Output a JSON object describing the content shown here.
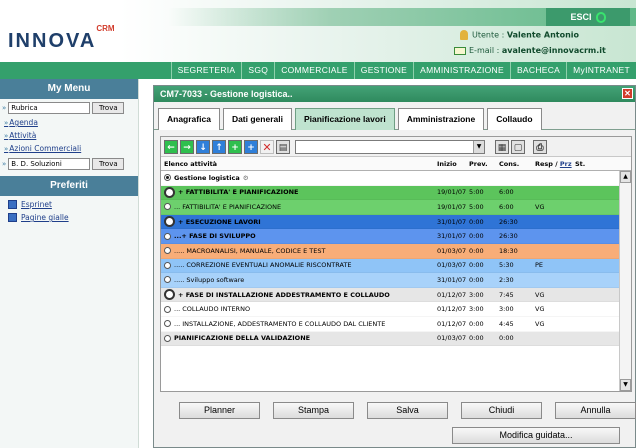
{
  "header": {
    "logo": "INNOVA",
    "logo_sup": "CRM",
    "exit_label": "ESCI",
    "user_label": "Utente :",
    "user_name": "Valente Antonio",
    "email_label": "E-mail :",
    "email": "avalente@innovacrm.it"
  },
  "nav": [
    "SEGRETERIA",
    "SGQ",
    "COMMERCIALE",
    "GESTIONE",
    "AMMINISTRAZIONE",
    "BACHECA",
    "MyINTRANET"
  ],
  "sidebar": {
    "title": "My Menu",
    "search1_value": "Rubrica",
    "search_button": "Trova",
    "links": [
      "Agenda",
      "Attività",
      "Azioni Commerciali"
    ],
    "search2_value": "B. D. Soluzioni",
    "prefs_title": "Preferiti",
    "prefs": [
      "Esprinet",
      "Pagine gialle"
    ]
  },
  "window": {
    "title": "CM7-7033 - Gestione logistica..",
    "tabs": [
      "Anagrafica",
      "Dati generali",
      "Pianificazione lavori",
      "Amministrazione",
      "Collaudo"
    ],
    "active_tab": "Pianificazione lavori"
  },
  "table": {
    "headers": {
      "name": "Elenco attività",
      "inizio": "Inizio",
      "prev": "Prev.",
      "cons": "Cons.",
      "resp": "Resp",
      "prz": "Prz",
      "st": "St."
    },
    "root": "Gestione logistica",
    "rows": [
      {
        "name": "+ FATTIBILITA' E PIANIFICAZIONE",
        "inizio": "19/01/07",
        "prev": "5:00",
        "cons": "6:00",
        "resp": "",
        "color": "#5cc45c",
        "bold": true,
        "big": true
      },
      {
        "name": "... FATTIBILITA' E PIANIFICAZIONE",
        "inizio": "19/01/07",
        "prev": "5:00",
        "cons": "6:00",
        "resp": "VG",
        "color": "#6dd06d",
        "bold": false,
        "big": false
      },
      {
        "name": "+ ESECUZIONE LAVORI",
        "inizio": "31/01/07",
        "prev": "0:00",
        "cons": "26:30",
        "resp": "",
        "color": "#2f74d6",
        "bold": true,
        "big": true
      },
      {
        "name": "...+ FASE DI SVILUPPO",
        "inizio": "31/01/07",
        "prev": "0:00",
        "cons": "26:30",
        "resp": "",
        "color": "#5d94ee",
        "bold": true,
        "big": false
      },
      {
        "name": "..... MACROANALISI, MANUALE, CODICE E TEST",
        "inizio": "01/03/07",
        "prev": "0:00",
        "cons": "18:30",
        "resp": "",
        "color": "#f8ad78",
        "bold": false,
        "big": false
      },
      {
        "name": "..... CORREZIONE EVENTUALI ANOMALIE RISCONTRATE",
        "inizio": "01/03/07",
        "prev": "0:00",
        "cons": "5:30",
        "resp": "PE",
        "color": "#8fc4f7",
        "bold": false,
        "big": false
      },
      {
        "name": "..... Sviluppo software",
        "inizio": "31/01/07",
        "prev": "0:00",
        "cons": "2:30",
        "resp": "",
        "color": "#a8d2fa",
        "bold": false,
        "big": false
      },
      {
        "name": "+ FASE DI INSTALLAZIONE ADDESTRAMENTO E COLLAUDO",
        "inizio": "01/12/07",
        "prev": "3:00",
        "cons": "7:45",
        "resp": "VG",
        "color": "#e6e6e6",
        "bold": true,
        "big": true
      },
      {
        "name": "... COLLAUDO INTERNO",
        "inizio": "01/12/07",
        "prev": "3:00",
        "cons": "3:00",
        "resp": "VG",
        "color": "#ffffff",
        "bold": false,
        "big": false
      },
      {
        "name": "... INSTALLAZIONE, ADDESTRAMENTO E COLLAUDO DAL CLIENTE",
        "inizio": "01/12/07",
        "prev": "0:00",
        "cons": "4:45",
        "resp": "VG",
        "color": "#ffffff",
        "bold": false,
        "big": false
      },
      {
        "name": "PIANIFICAZIONE DELLA VALIDAZIONE",
        "inizio": "01/03/07",
        "prev": "0:00",
        "cons": "0:00",
        "resp": "",
        "color": "#e6e6e6",
        "bold": true,
        "big": false
      }
    ]
  },
  "buttons": {
    "planner": "Planner",
    "stampa": "Stampa",
    "salva": "Salva",
    "chiudi": "Chiudi",
    "annulla": "Annulla",
    "modifica": "Modifica guidata..."
  },
  "toolbar_icons": [
    "arrow-left-icon",
    "arrow-right-icon",
    "arrow-down-icon",
    "arrow-up-icon",
    "add-icon",
    "add-sub-icon",
    "delete-icon",
    "print-preview-icon",
    "open-icon",
    "new-icon",
    "print-icon"
  ]
}
